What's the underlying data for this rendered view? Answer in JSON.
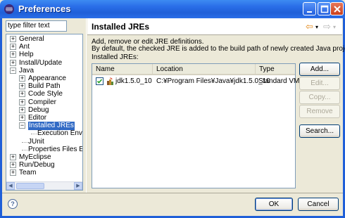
{
  "window": {
    "title": "Preferences"
  },
  "filter": {
    "value": "type filter text"
  },
  "tree": {
    "items": [
      {
        "label": "General",
        "expander": "+",
        "depth": 0
      },
      {
        "label": "Ant",
        "expander": "+",
        "depth": 0
      },
      {
        "label": "Help",
        "expander": "+",
        "depth": 0
      },
      {
        "label": "Install/Update",
        "expander": "+",
        "depth": 0
      },
      {
        "label": "Java",
        "expander": "−",
        "depth": 0
      },
      {
        "label": "Appearance",
        "expander": "+",
        "depth": 1
      },
      {
        "label": "Build Path",
        "expander": "+",
        "depth": 1
      },
      {
        "label": "Code Style",
        "expander": "+",
        "depth": 1
      },
      {
        "label": "Compiler",
        "expander": "+",
        "depth": 1
      },
      {
        "label": "Debug",
        "expander": "+",
        "depth": 1
      },
      {
        "label": "Editor",
        "expander": "+",
        "depth": 1
      },
      {
        "label": "Installed JREs",
        "expander": "−",
        "depth": 1,
        "selected": true
      },
      {
        "label": "Execution Enviro",
        "expander": "",
        "depth": 2
      },
      {
        "label": "JUnit",
        "expander": "",
        "depth": 1
      },
      {
        "label": "Properties Files Edi",
        "expander": "",
        "depth": 1
      },
      {
        "label": "MyEclipse",
        "expander": "+",
        "depth": 0
      },
      {
        "label": "Run/Debug",
        "expander": "+",
        "depth": 0
      },
      {
        "label": "Team",
        "expander": "+",
        "depth": 0
      }
    ]
  },
  "page": {
    "title": "Installed JREs",
    "nav_back": "⇦",
    "nav_forward": "⇨",
    "desc_line1": "Add, remove or edit JRE definitions.",
    "desc_line2": "By default, the checked JRE is added to the build path of newly created Java projects.",
    "table_label": "Installed JREs:"
  },
  "table": {
    "columns": [
      "Name",
      "Location",
      "Type"
    ],
    "rows": [
      {
        "name": "jdk1.5.0_10",
        "location": "C:¥Program Files¥Java¥jdk1.5.0_10",
        "type": "Standard VM",
        "checked": true
      }
    ]
  },
  "buttons": {
    "add": "Add...",
    "edit": "Edit...",
    "copy": "Copy...",
    "remove": "Remove",
    "search": "Search...",
    "ok": "OK",
    "cancel": "Cancel",
    "help": "?"
  },
  "colors": {
    "titlebar": "#2a6ee8",
    "selection": "#316ac5"
  }
}
